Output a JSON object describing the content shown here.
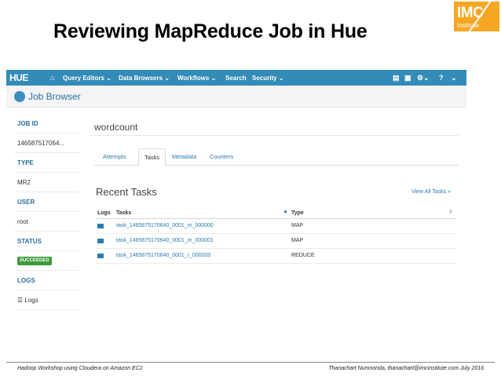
{
  "slide": {
    "title": "Reviewing MapReduce Job in Hue",
    "logo": {
      "big": "IMC",
      "small": "Institute"
    },
    "footer_left": "Hadoop Workshop using Cloudera on Amazon EC2",
    "footer_right": "Thanachart Numnonda, thanachart@imcinstitute.com July 2016"
  },
  "hue": {
    "logo": "HUE",
    "nav": {
      "home_icon": "home-icon",
      "items": [
        "Query Editors ⌄",
        "Data Browsers ⌄",
        "Workflows ⌄",
        "Search",
        "Security ⌄"
      ],
      "right_icons": [
        "file-icon",
        "table-icon",
        "settings-icon",
        "help-icon"
      ]
    },
    "app_title": "Job Browser",
    "sidebar": {
      "job_id_label": "JOB ID",
      "job_id_value": "146587517064...",
      "type_label": "TYPE",
      "type_value": "MR2",
      "user_label": "USER",
      "user_value": "root",
      "status_label": "STATUS",
      "status_value": "SUCCEEDED",
      "logs_label": "LOGS",
      "logs_link": "Logs"
    },
    "main": {
      "job_name": "wordcount",
      "tabs": [
        "Attempts",
        "Tasks",
        "Metadata",
        "Counters"
      ],
      "active_tab": "Tasks",
      "section_title": "Recent Tasks",
      "view_all": "View All Tasks »",
      "table": {
        "headers": [
          "Logs",
          "Tasks",
          "Type"
        ],
        "rows": [
          {
            "task": "task_1465875170640_0001_m_000000",
            "type": "MAP"
          },
          {
            "task": "task_1465875170640_0001_m_000001",
            "type": "MAP"
          },
          {
            "task": "task_1465875170640_0001_r_000000",
            "type": "REDUCE"
          }
        ]
      }
    }
  },
  "colors": {
    "navbar": "#338bb8",
    "link": "#2a7aad",
    "success": "#3c9a3c",
    "logo": "#f5a623"
  }
}
